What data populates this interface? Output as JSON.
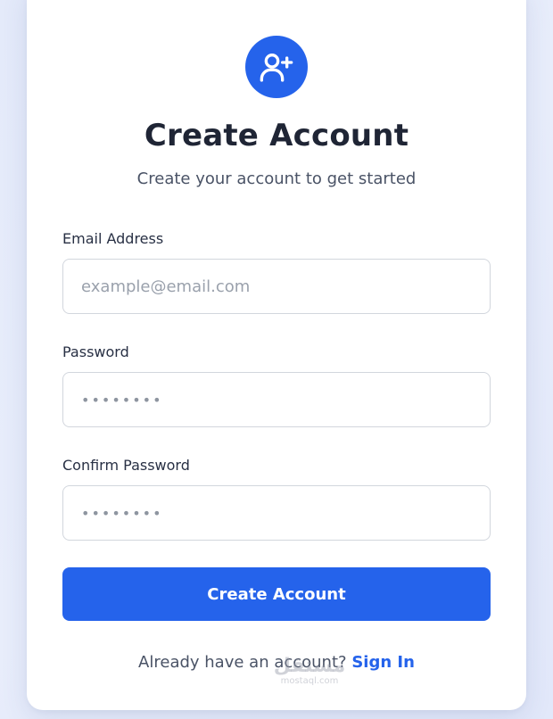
{
  "colors": {
    "accent": "#2563eb",
    "heading": "#1f2535",
    "muted": "#4a5366",
    "placeholder": "#9aa1ac",
    "border": "#d2d6dd"
  },
  "header": {
    "icon": "user-plus-icon",
    "title": "Create Account",
    "subtitle": "Create your account to get started"
  },
  "form": {
    "email": {
      "label": "Email Address",
      "placeholder": "example@email.com",
      "value": ""
    },
    "password": {
      "label": "Password",
      "value": "••••••••"
    },
    "confirm_password": {
      "label": "Confirm Password",
      "value": "••••••••"
    },
    "submit_label": "Create Account"
  },
  "footer": {
    "prompt": "Already have an account?",
    "link_label": "Sign In"
  },
  "watermark": {
    "brand": "مستقل",
    "domain": "mostaql.com"
  }
}
